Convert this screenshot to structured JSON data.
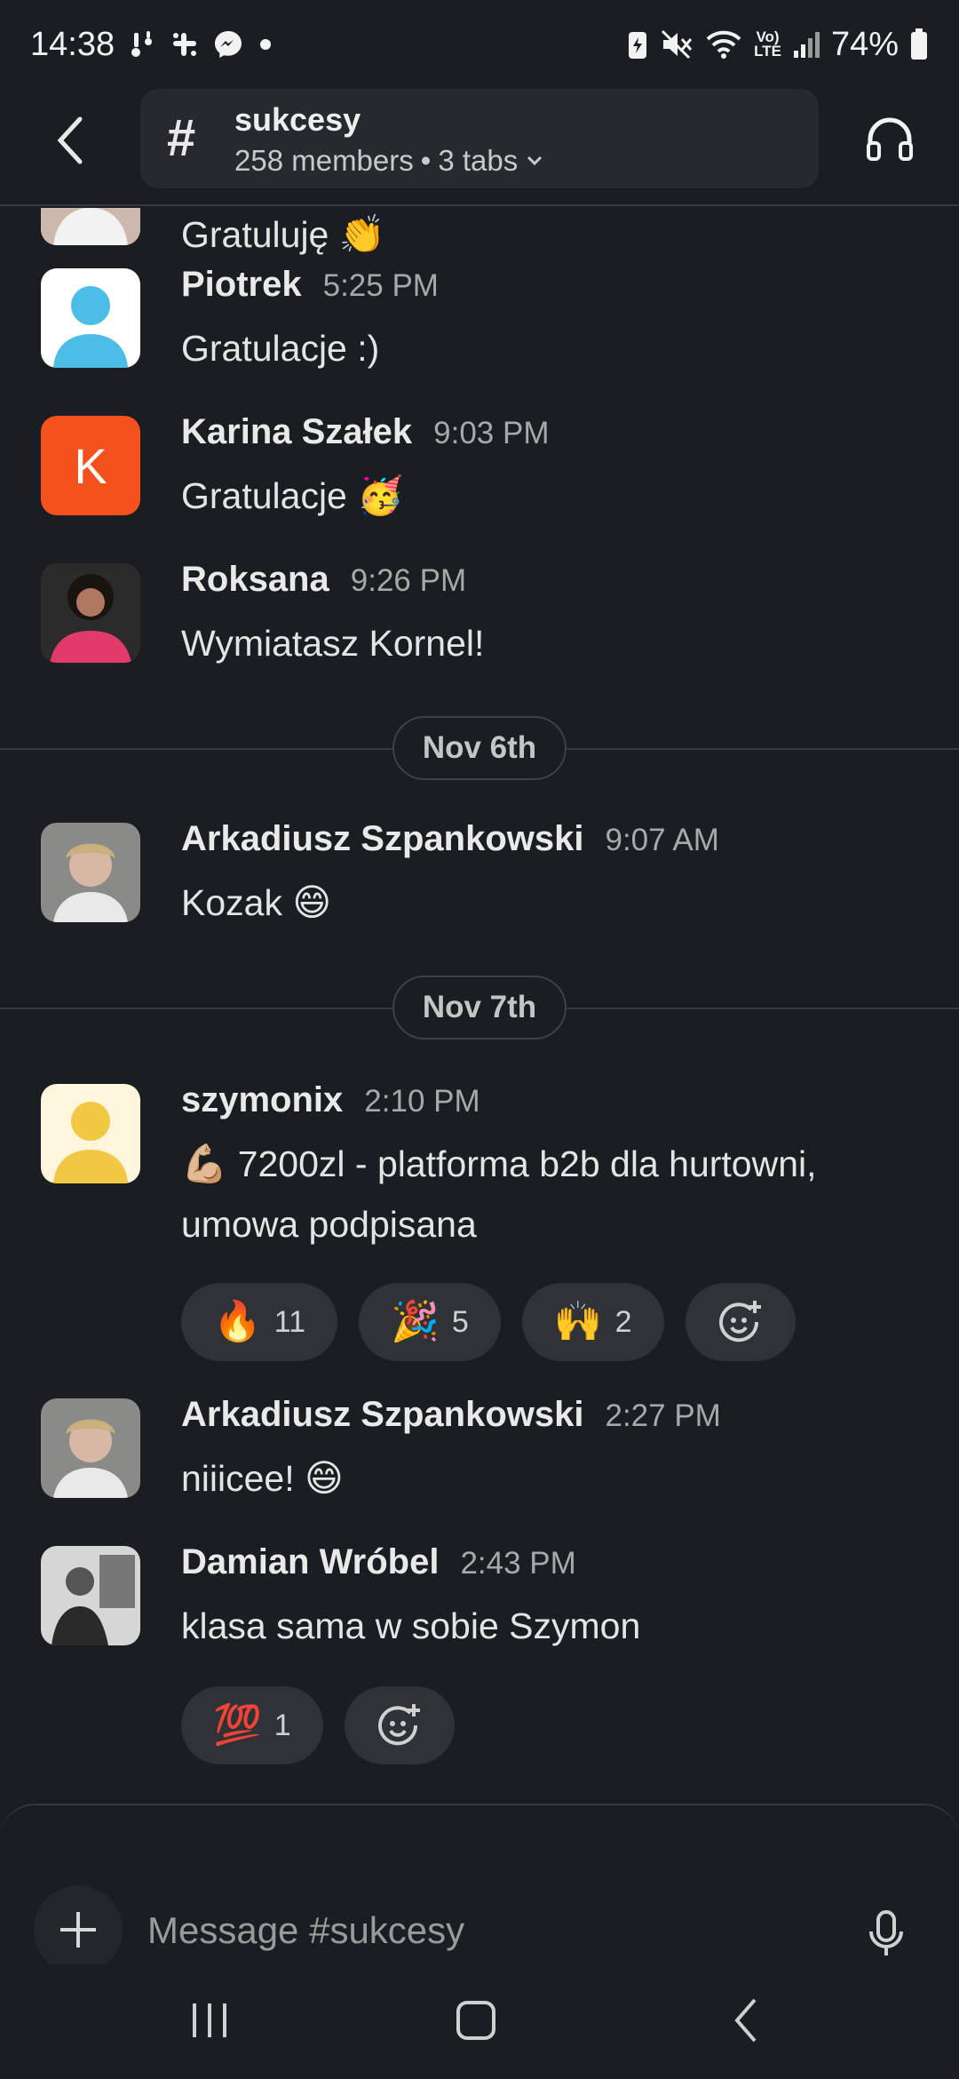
{
  "status_bar": {
    "time": "14:38",
    "battery": "74%",
    "volte_top": "Vo)",
    "volte_bottom": "LTE",
    "left_icons": [
      "notification-icon",
      "slack-icon",
      "messenger-icon",
      "dot-icon"
    ],
    "right_icons": [
      "battery-saver-icon",
      "mute-icon",
      "wifi-icon",
      "volte-icon",
      "signal-icon",
      "battery-icon"
    ]
  },
  "header": {
    "channel_name": "sukcesy",
    "members": "258 members",
    "separator": "•",
    "tabs": "3 tabs"
  },
  "messages": [
    {
      "author": "Piotrek",
      "time": "5:25 PM",
      "text": "Gratulacje :)",
      "emoji": ""
    },
    {
      "author": "Karina Szałek",
      "time": "9:03 PM",
      "text": "Gratulacje",
      "emoji": "🥳",
      "avatar_letter": "K"
    },
    {
      "author": "Roksana",
      "time": "9:26 PM",
      "text": "Wymiatasz Kornel!",
      "emoji": ""
    },
    {
      "author": "Arkadiusz Szpankowski",
      "time": "9:07 AM",
      "text": "Kozak",
      "emoji": "😄"
    },
    {
      "author": "szymonix",
      "time": "2:10 PM",
      "text_prefix_emoji": "💪🏼",
      "text": "7200zl - platforma b2b dla hurtowni, umowa podpisana",
      "emoji": ""
    },
    {
      "author": "Arkadiusz Szpankowski",
      "time": "2:27 PM",
      "text": "niiicee!",
      "emoji": "😄"
    },
    {
      "author": "Damian Wróbel",
      "time": "2:43 PM",
      "text": "klasa sama w sobie Szymon",
      "emoji": ""
    }
  ],
  "partial_message": {
    "text": "Gratuluję",
    "emoji": "👏"
  },
  "dates": [
    "Nov 6th",
    "Nov 7th"
  ],
  "reactions_szymonix": [
    {
      "emoji": "🔥",
      "count": "11"
    },
    {
      "emoji": "🎉",
      "count": "5"
    },
    {
      "emoji": "🙌",
      "count": "2"
    }
  ],
  "reactions_damian": [
    {
      "emoji": "💯",
      "count": "1"
    }
  ],
  "composer": {
    "placeholder": "Message #sukcesy"
  },
  "colors": {
    "background": "#1a1d21",
    "karina_avatar": "#f4511e",
    "piotrek_avatar": "#4bbde6",
    "szymonix_avatar": "#f2c744"
  }
}
